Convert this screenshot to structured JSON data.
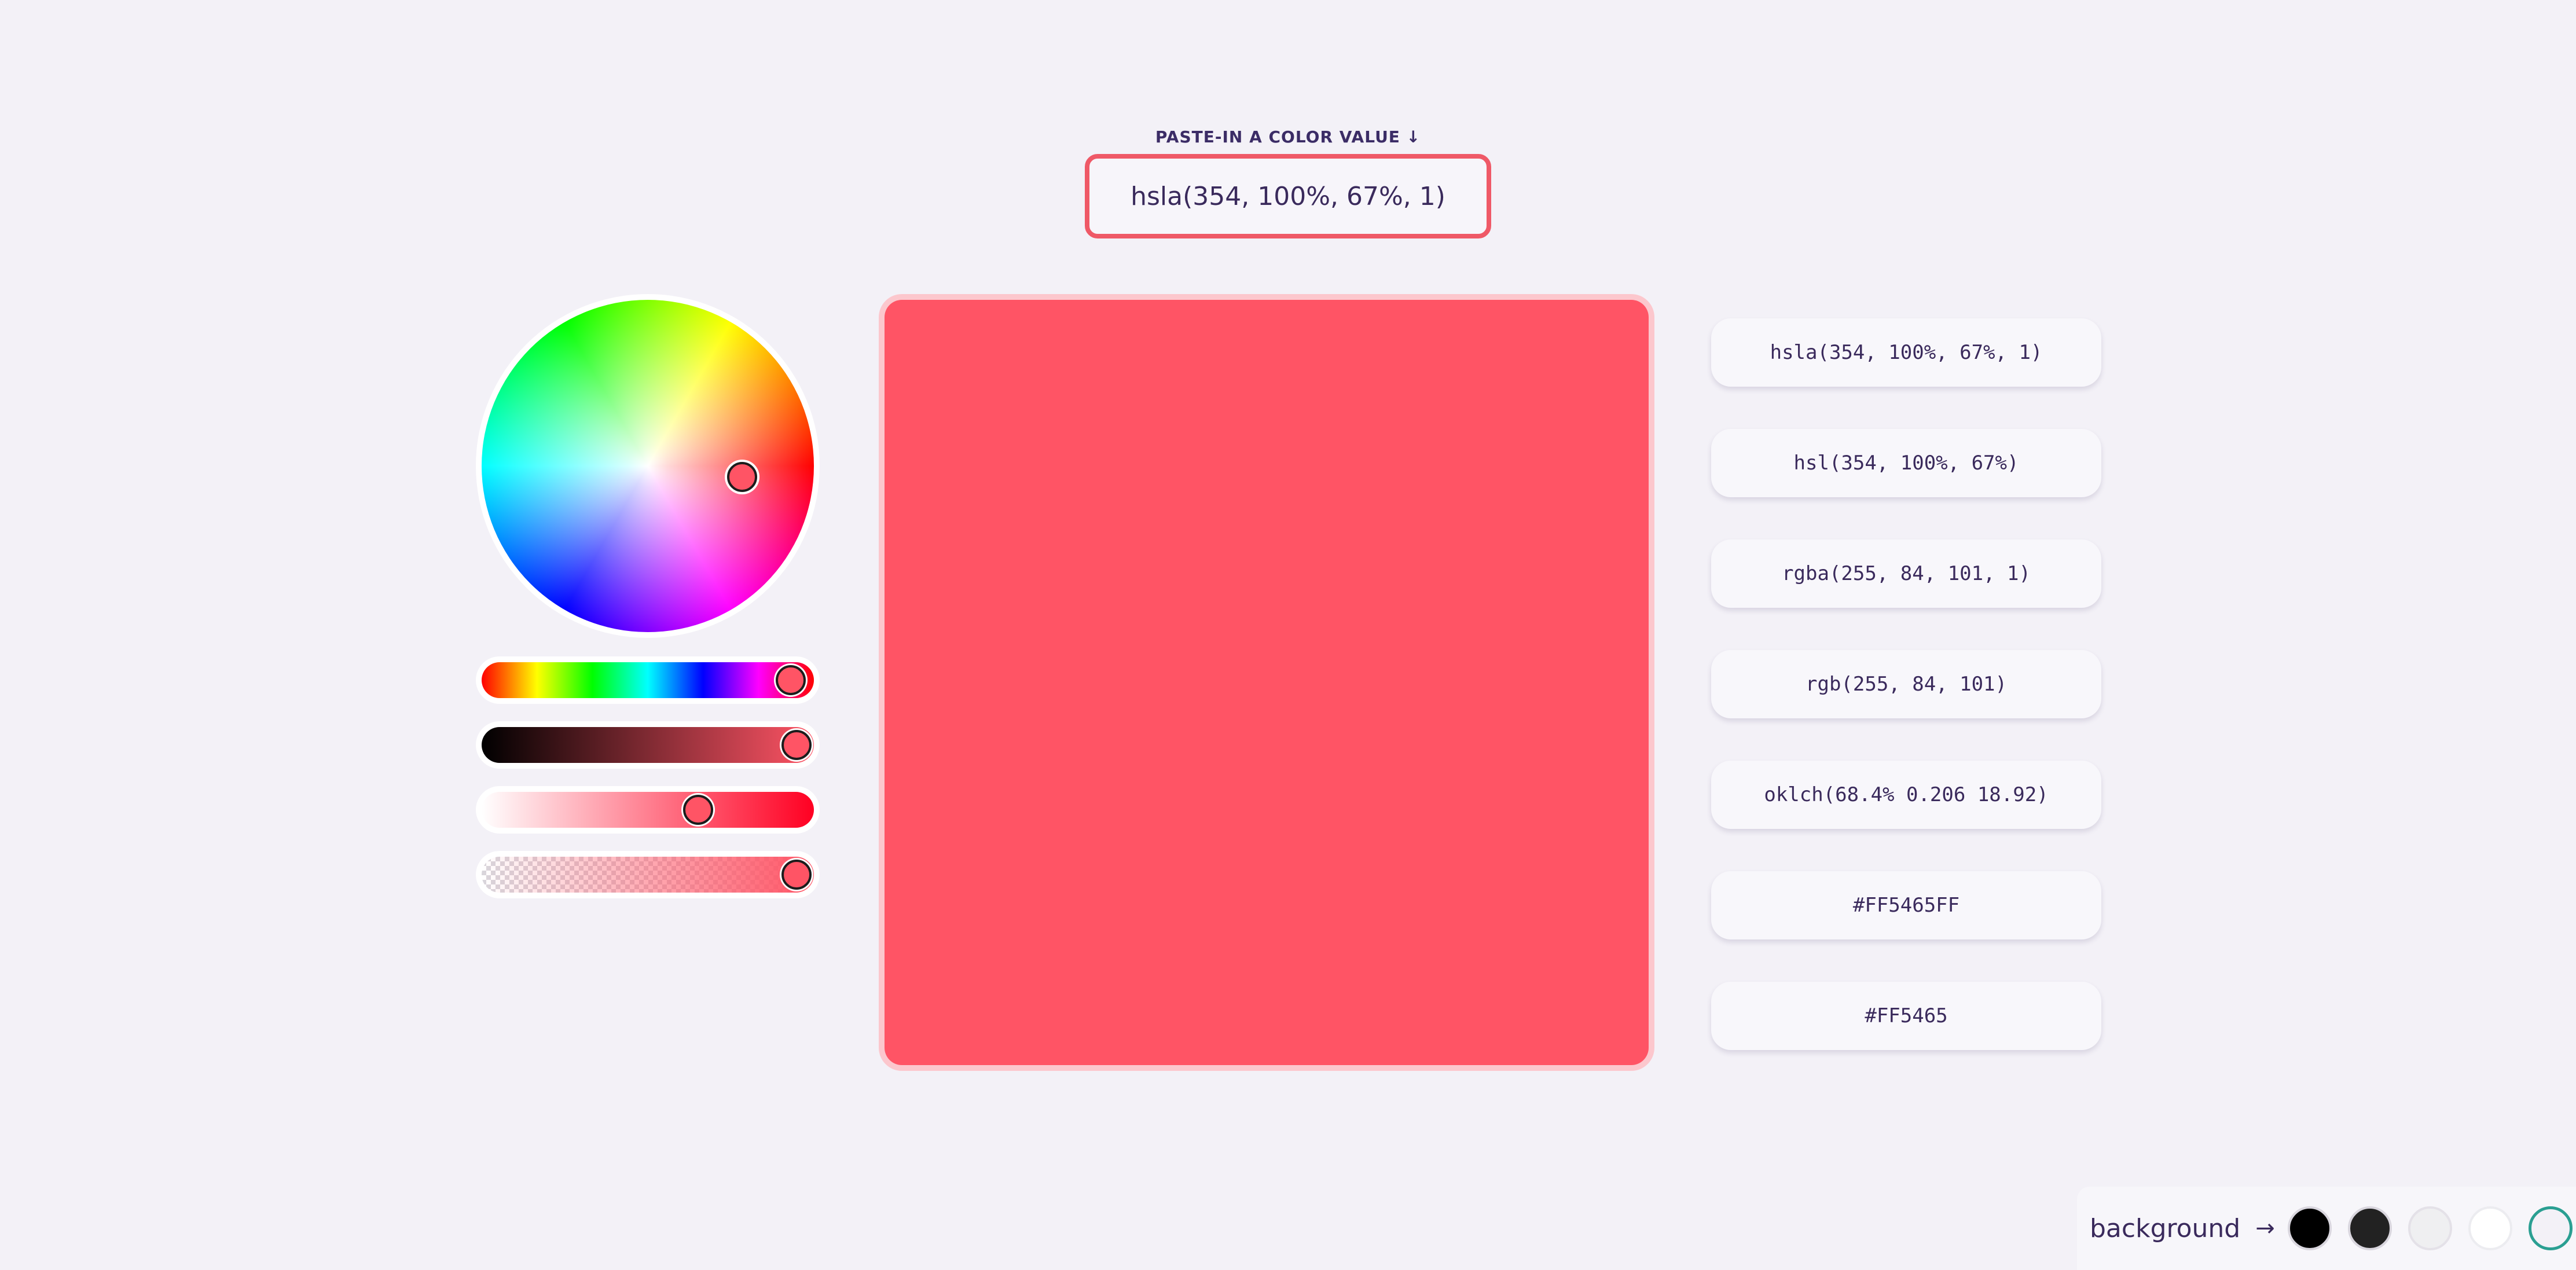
{
  "input": {
    "label": "PASTE-IN A COLOR VALUE ↓",
    "value": "hsla(354, 100%, 67%, 1)"
  },
  "color": {
    "hex": "#FF5465",
    "frame_tint": "#FCC7CD",
    "hue_deg": 354,
    "saturation_pct": 100,
    "lightness_pct": 67,
    "alpha": 1
  },
  "formats": [
    "hsla(354, 100%, 67%, 1)",
    "hsl(354, 100%, 67%)",
    "rgba(255, 84, 101, 1)",
    "rgb(255, 84, 101)",
    "oklch(68.4% 0.206 18.92)",
    "#FF5465FF",
    "#FF5465"
  ],
  "background_picker": {
    "label": "background",
    "arrow": "→",
    "swatches": [
      "#000000",
      "#222222",
      "#efeff1",
      "#ffffff",
      "#f3f1f7"
    ],
    "selected_index": 4,
    "selected_ring_color": "#2a9f92"
  },
  "page_background": "#f3f1f7"
}
